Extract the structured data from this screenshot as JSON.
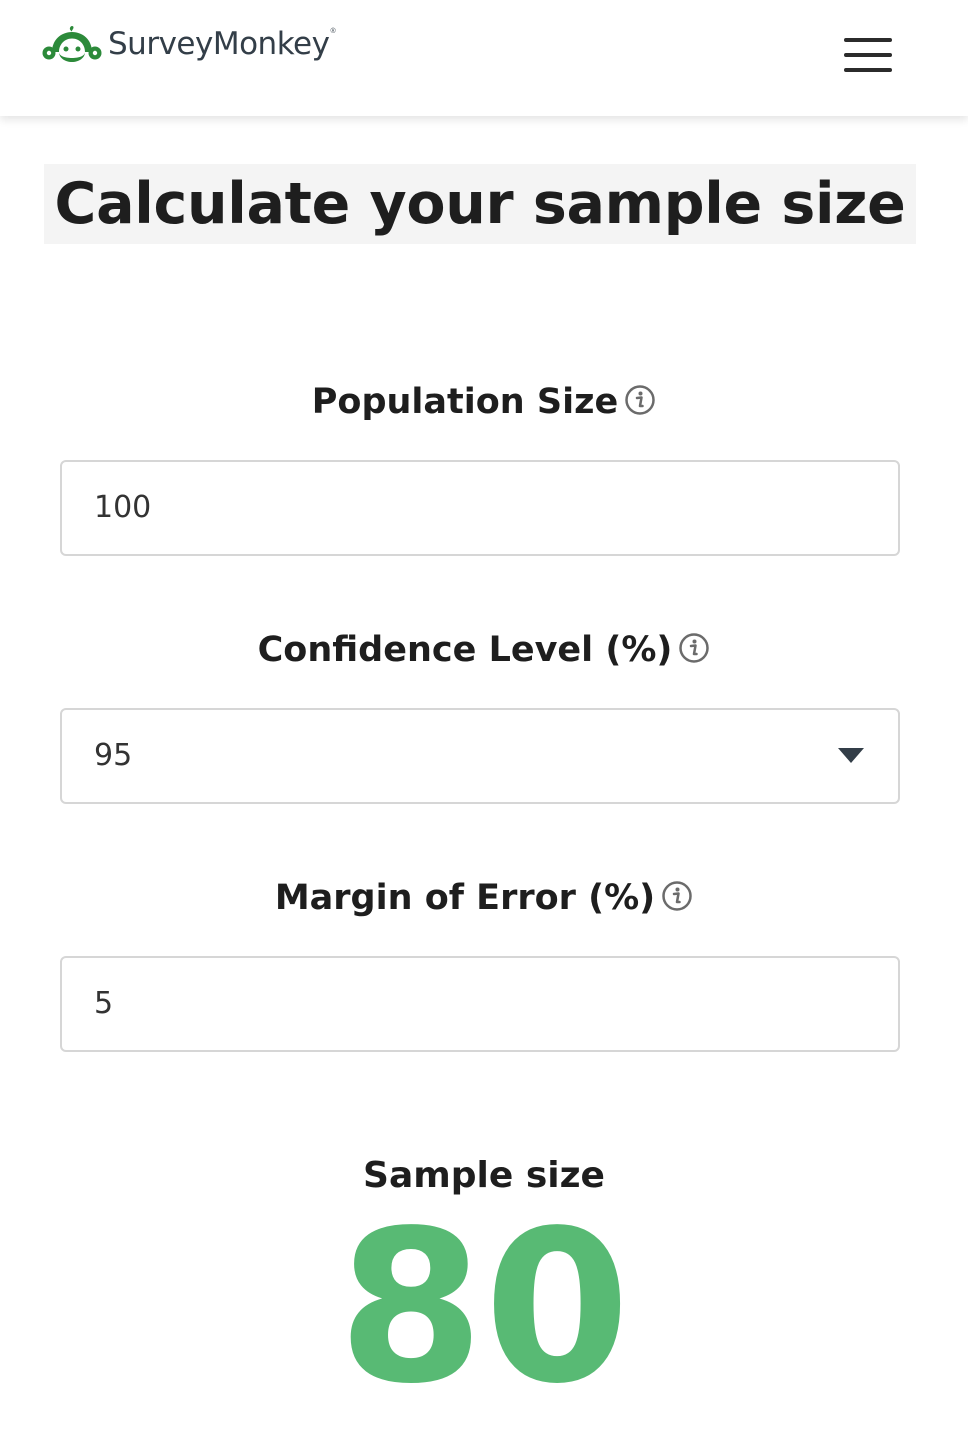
{
  "header": {
    "logo_text": "SurveyMonkey",
    "logo_tm": "®",
    "logo_icon": "surveymonkey-logo-icon",
    "menu_icon": "hamburger-menu-icon",
    "brand_color": "#2c8a3a"
  },
  "main": {
    "title": "Calculate your sample size",
    "fields": [
      {
        "label": "Population Size",
        "value": "100",
        "icon": "info-icon"
      },
      {
        "label": "Confidence Level (%)",
        "value": "95",
        "icon": "info-icon",
        "control": "dropdown",
        "arrow_icon": "caret-down-icon"
      },
      {
        "label": "Margin of Error (%)",
        "value": "5",
        "icon": "info-icon"
      }
    ],
    "result": {
      "label": "Sample size",
      "value": "80",
      "color": "#58ba74"
    }
  }
}
